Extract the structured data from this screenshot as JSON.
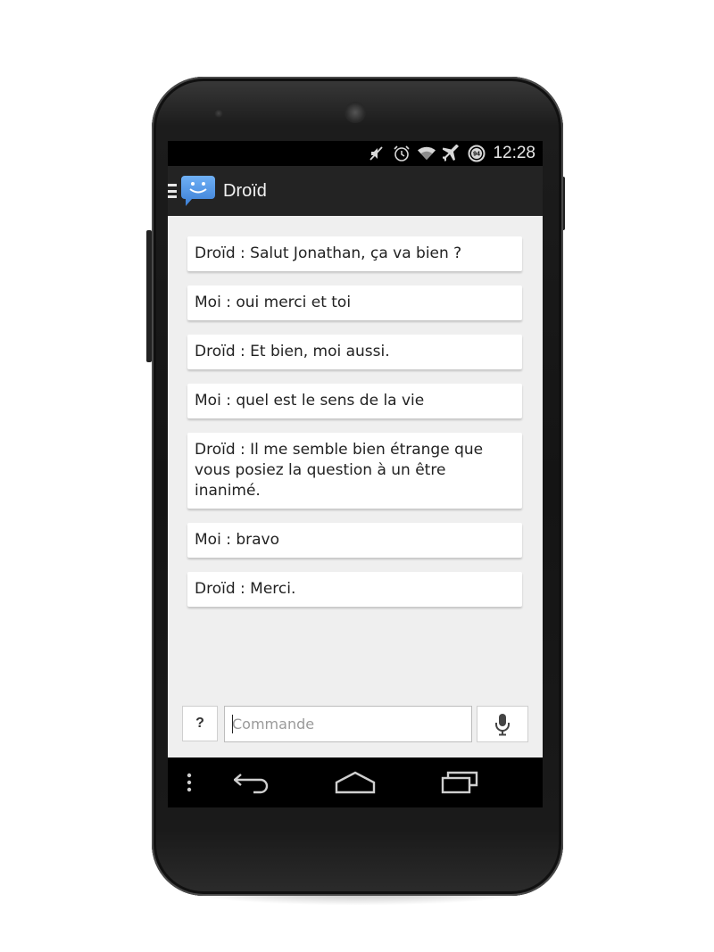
{
  "status_bar": {
    "time": "12:28",
    "battery_level": "94",
    "icons": [
      "mute-icon",
      "alarm-icon",
      "wifi-icon",
      "airplane-mode-icon",
      "battery-icon"
    ]
  },
  "action_bar": {
    "title": "Droïd",
    "menu_icon": "menu-icon",
    "logo_icon": "chat-bubble-smiley-icon"
  },
  "messages": [
    {
      "text": "Droïd : Salut Jonathan, ça va bien ?"
    },
    {
      "text": "Moi : oui merci et toi"
    },
    {
      "text": "Droïd : Et bien, moi aussi."
    },
    {
      "text": "Moi : quel est le sens de la vie"
    },
    {
      "text": "Droïd : Il me semble bien étrange que vous posiez la question à un être inanimé."
    },
    {
      "text": "Moi : bravo"
    },
    {
      "text": "Droïd : Merci."
    }
  ],
  "input": {
    "help_label": "?",
    "placeholder": "Commande",
    "value": "",
    "mic_icon": "microphone-icon"
  },
  "nav_bar": {
    "icons": [
      "overflow-menu-icon",
      "back-icon",
      "home-icon",
      "recent-apps-icon"
    ]
  },
  "colors": {
    "action_bar": "#232323",
    "content_bg": "#efefef",
    "logo_blue": "#4a8fe0"
  }
}
